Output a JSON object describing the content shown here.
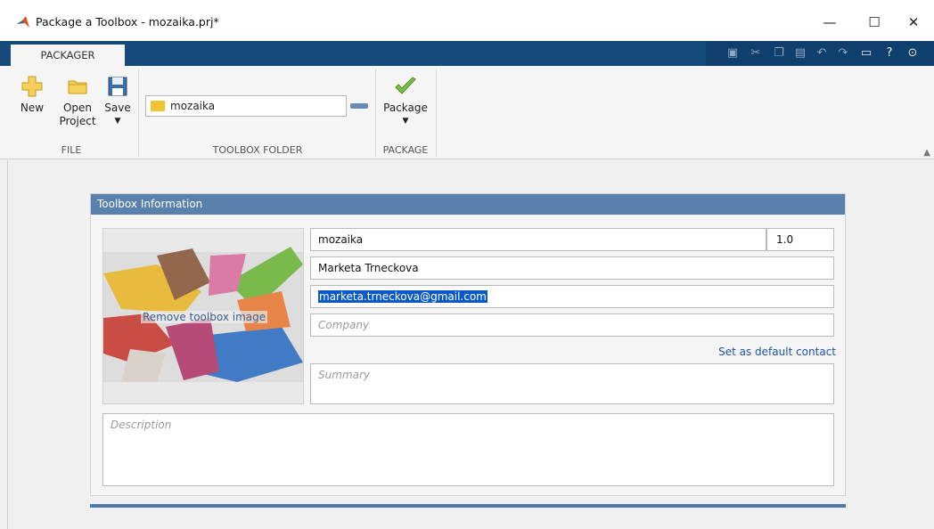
{
  "window": {
    "title": "Package a Toolbox - mozaika.prj*",
    "controls": [
      "—",
      "☐",
      "✕"
    ]
  },
  "ribbon": {
    "tab": "PACKAGER",
    "file_group": {
      "label": "FILE",
      "new_label": "New",
      "open_label_1": "Open",
      "open_label_2": "Project",
      "save_label": "Save",
      "save_arrow": "▼"
    },
    "folder_group": {
      "label": "TOOLBOX FOLDER",
      "folder_value": "mozaika"
    },
    "package_group": {
      "label": "PACKAGE",
      "package_label": "Package",
      "package_arrow": "▼"
    },
    "quick_access_icons": [
      "save-icon",
      "cut-icon",
      "copy-icon",
      "paste-icon",
      "undo-icon",
      "redo-icon",
      "window-icon",
      "help-icon",
      "menu-icon"
    ]
  },
  "toolbox_info": {
    "header": "Toolbox Information",
    "remove_image_label": "Remove toolbox image",
    "name": "mozaika",
    "version": "1.0",
    "author": "Marketa Trneckova",
    "email": "marketa.trneckova@gmail.com",
    "company_placeholder": "Company",
    "default_contact_label": "Set as default contact",
    "summary_placeholder": "Summary",
    "description_placeholder": "Description"
  },
  "colors": {
    "tab_strip": "#154a7a",
    "panel_header": "#5a80ad",
    "selection": "#0b58c6",
    "link": "#1b55a1"
  }
}
